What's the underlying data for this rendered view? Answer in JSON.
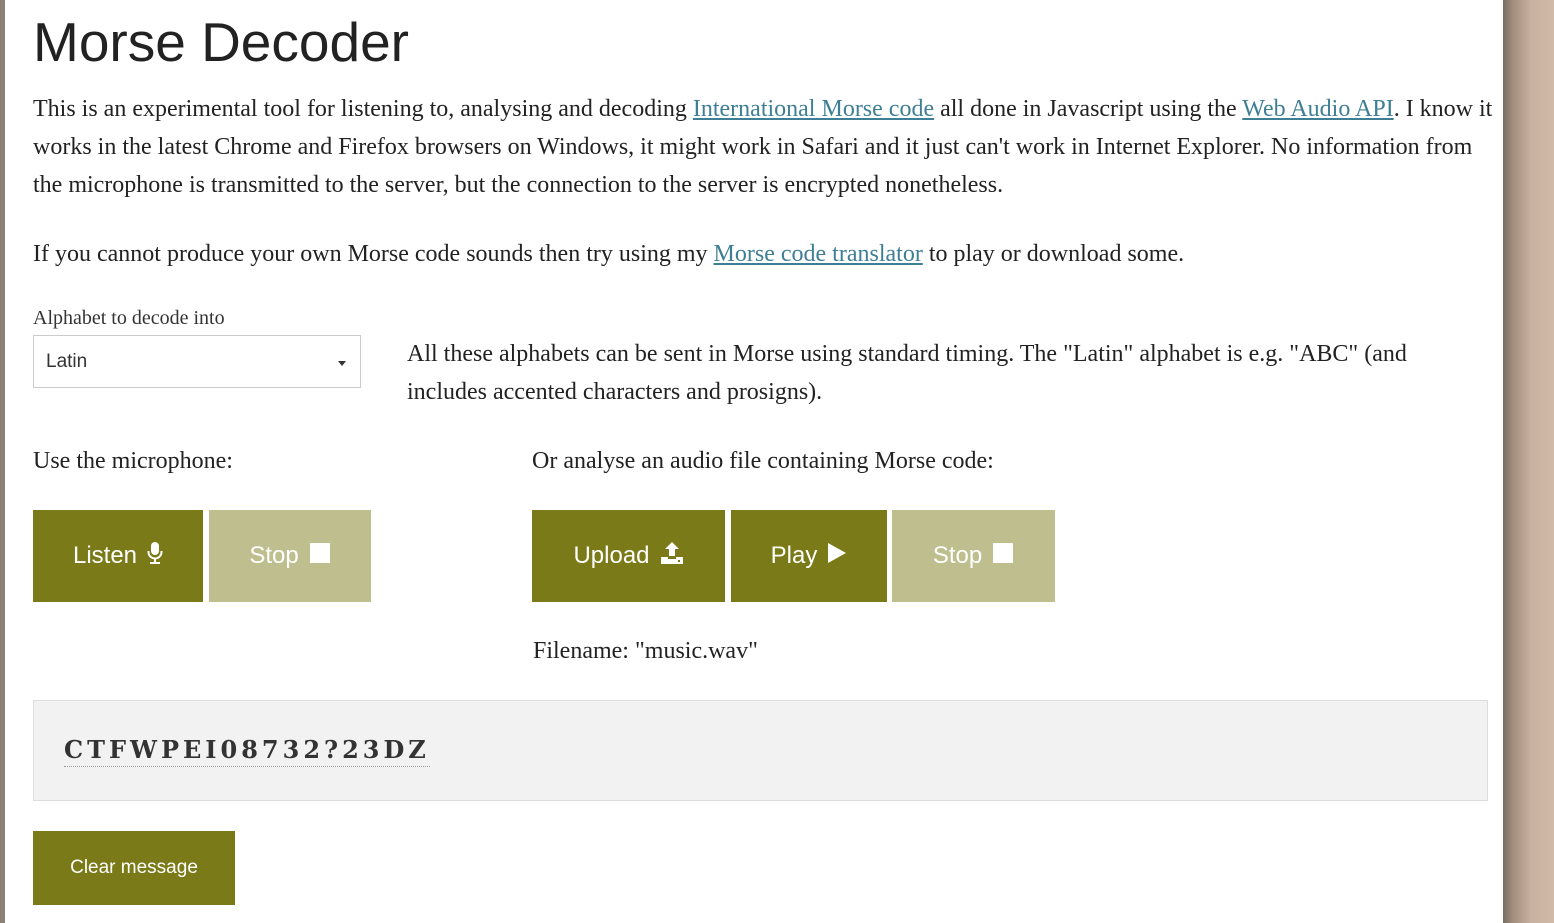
{
  "page": {
    "title": "Morse Decoder"
  },
  "intro": {
    "part1": "This is an experimental tool for listening to, analysing and decoding ",
    "link_morse": "International Morse code",
    "part2": " all done in Javascript using the ",
    "link_webaudio": "Web Audio API",
    "part3": ". I know it works in the latest Chrome and Firefox browsers on Windows, it might work in Safari and it just can't work in Internet Explorer. No information from the microphone is transmitted to the server, but the connection to the server is encrypted nonetheless."
  },
  "translator_note": {
    "part1": "If you cannot produce your own Morse code sounds then try using my ",
    "link": "Morse code translator",
    "part2": " to play or download some."
  },
  "alphabet": {
    "label": "Alphabet to decode into",
    "selected": "Latin",
    "note": "All these alphabets can be sent in Morse using standard timing. The \"Latin\" alphabet is e.g. \"ABC\" (and includes accented characters and prosigns)."
  },
  "microphone": {
    "label": "Use the microphone:",
    "listen_label": "Listen",
    "listen_icon": "microphone-icon",
    "stop_label": "Stop",
    "stop_icon": "stop-square-icon"
  },
  "file": {
    "label": "Or analyse an audio file containing Morse code:",
    "upload_label": "Upload",
    "upload_icon": "upload-icon",
    "play_label": "Play",
    "play_icon": "play-triangle-icon",
    "stop_label": "Stop",
    "stop_icon": "stop-square-icon",
    "filename": "Filename: \"music.wav\""
  },
  "output": {
    "message": "CTFWPEI08732?23DZ",
    "clear_label": "Clear message"
  },
  "colors": {
    "button_active": "#7a7a18",
    "button_disabled": "#bebe8e",
    "link": "#3e7f95",
    "message_bg": "#f2f2f2"
  }
}
